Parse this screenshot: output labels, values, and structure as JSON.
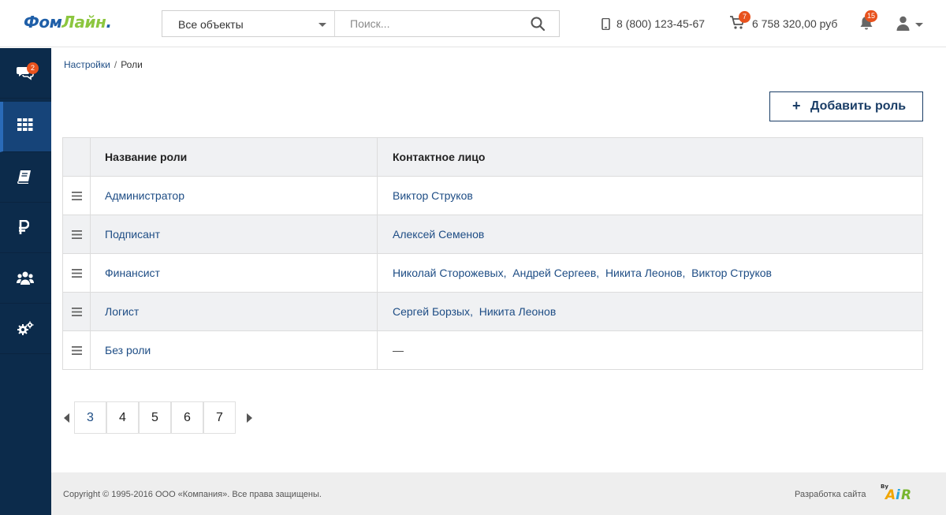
{
  "header": {
    "logo": {
      "part1": "Фом",
      "part2": "Лайн",
      "part3": "."
    },
    "objects_select": "Все объекты",
    "search_placeholder": "Поиск...",
    "phone": "8 (800) 123-45-67",
    "cart_count": "7",
    "cart_total": "6 758 320,00 руб",
    "notifications_count": "15"
  },
  "sidebar": {
    "items": [
      {
        "icon": "chat-icon",
        "badge": "2"
      },
      {
        "icon": "grid-icon",
        "active": true
      },
      {
        "icon": "book-icon"
      },
      {
        "icon": "ruble-icon"
      },
      {
        "icon": "users-icon"
      },
      {
        "icon": "gears-icon"
      }
    ]
  },
  "breadcrumb": {
    "parent": "Настройки",
    "separator": "/",
    "current": "Роли"
  },
  "add_button": {
    "plus": "+",
    "label": "Добавить роль"
  },
  "table": {
    "headers": {
      "role": "Название роли",
      "contact": "Контактное лицо"
    },
    "rows": [
      {
        "role": "Администратор",
        "contacts": [
          "Виктор Струков"
        ]
      },
      {
        "role": "Подписант",
        "contacts": [
          "Алексей Семенов"
        ]
      },
      {
        "role": "Финансист",
        "contacts": [
          "Николай Сторожевых",
          "Андрей Сергеев",
          "Никита Леонов",
          "Виктор Струков"
        ]
      },
      {
        "role": "Логист",
        "contacts": [
          "Сергей Борзых",
          "Никита Леонов"
        ]
      },
      {
        "role": "Без роли",
        "contacts": [
          "—"
        ]
      }
    ]
  },
  "pagination": {
    "pages": [
      "3",
      "4",
      "5",
      "6",
      "7"
    ],
    "current": "3"
  },
  "footer": {
    "copyright": "Copyright © 1995-2016 ООО «Компания». Все права защищены.",
    "dev_label": "Разработка сайта",
    "dev_logo": {
      "by": "By",
      "text_a": "A",
      "text_i": "i",
      "text_r": "R"
    }
  },
  "colors": {
    "sidebar": "#0c2b4b",
    "sidebar_active": "#164479",
    "link": "#1e4d85",
    "badge": "#e8521d",
    "logo_blue": "#1f5fa8",
    "logo_green": "#8cc63f"
  }
}
